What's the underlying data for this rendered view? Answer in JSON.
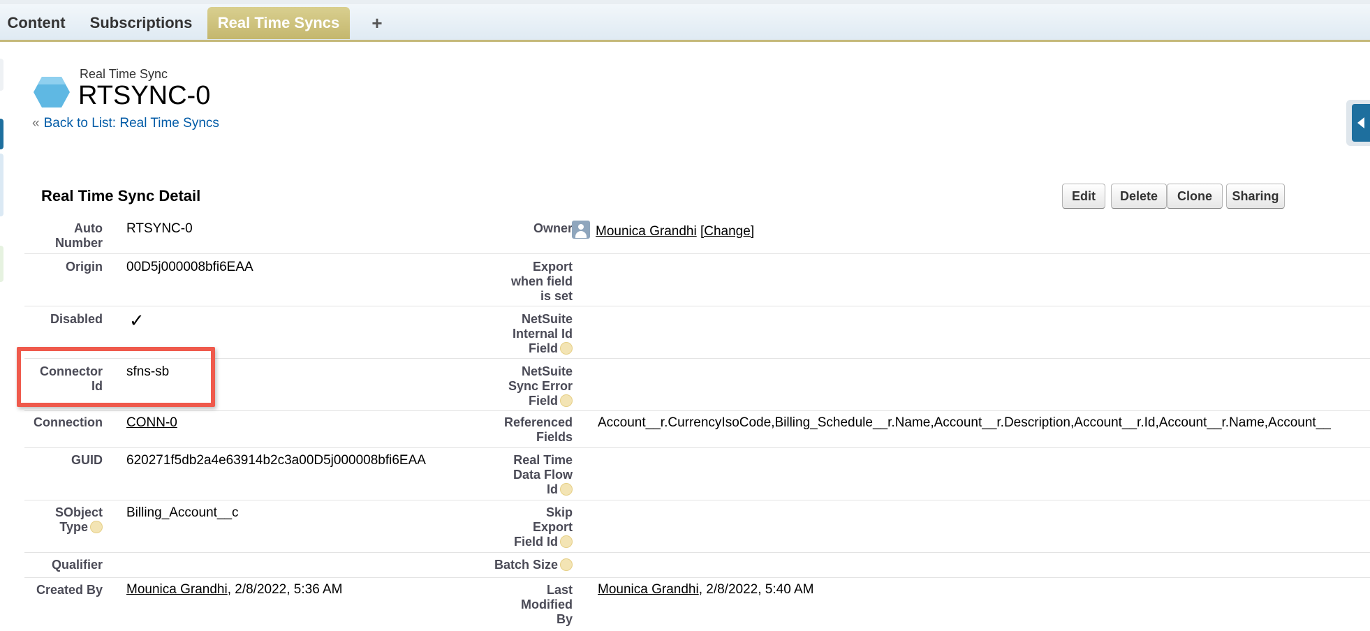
{
  "tabs": [
    {
      "label": "Content",
      "active": false
    },
    {
      "label": "Subscriptions",
      "active": false
    },
    {
      "label": "Real Time Syncs",
      "active": true
    }
  ],
  "add_tab_label": "+",
  "header": {
    "object_type": "Real Time Sync",
    "record_name": "RTSYNC-0",
    "back_prefix": "«",
    "back_link": "Back to List: Real Time Syncs"
  },
  "detail": {
    "section_title": "Real Time Sync Detail",
    "buttons": {
      "edit": "Edit",
      "delete": "Delete",
      "clone": "Clone",
      "sharing": "Sharing"
    },
    "auto_number": {
      "label": "Auto Number",
      "value": "RTSYNC-0"
    },
    "owner": {
      "label": "Owner",
      "name": "Mounica Grandhi",
      "change": "[Change]"
    },
    "origin": {
      "label": "Origin",
      "value": "00D5j000008bfi6EAA"
    },
    "export_when_field_is_set": {
      "label": "Export when field is set",
      "value": ""
    },
    "disabled": {
      "label": "Disabled",
      "checked": true,
      "glyph": "✓"
    },
    "netsuite_internal_id_field": {
      "label": "NetSuite Internal Id Field",
      "value": ""
    },
    "connector_id": {
      "label": "Connector Id",
      "value": "sfns-sb"
    },
    "netsuite_sync_error_field": {
      "label": "NetSuite Sync Error Field",
      "value": ""
    },
    "connection": {
      "label": "Connection",
      "value": "CONN-0"
    },
    "referenced_fields": {
      "label": "Referenced Fields",
      "value": "Account__r.CurrencyIsoCode,Billing_Schedule__r.Name,Account__r.Description,Account__r.Id,Account__r.Name,Account__"
    },
    "guid": {
      "label": "GUID",
      "value": "620271f5db2a4e63914b2c3a00D5j000008bfi6EAA"
    },
    "real_time_data_flow_id": {
      "label": "Real Time Data Flow Id",
      "value": ""
    },
    "sobject_type": {
      "label": "SObject Type",
      "value": "Billing_Account__c"
    },
    "skip_export_field_id": {
      "label": "Skip Export Field Id",
      "value": ""
    },
    "qualifier": {
      "label": "Qualifier",
      "value": ""
    },
    "batch_size": {
      "label": "Batch Size",
      "value": ""
    },
    "created_by": {
      "label": "Created By",
      "name": "Mounica Grandhi",
      "date": ", 2/8/2022, 5:36 AM"
    },
    "last_modified_by": {
      "label": "Last Modified By",
      "name": "Mounica Grandhi",
      "date": ", 2/8/2022, 5:40 AM"
    }
  },
  "colors": {
    "active_tab": "#c4b76e",
    "link": "#015ba7",
    "highlight": "#ef5a4c"
  }
}
